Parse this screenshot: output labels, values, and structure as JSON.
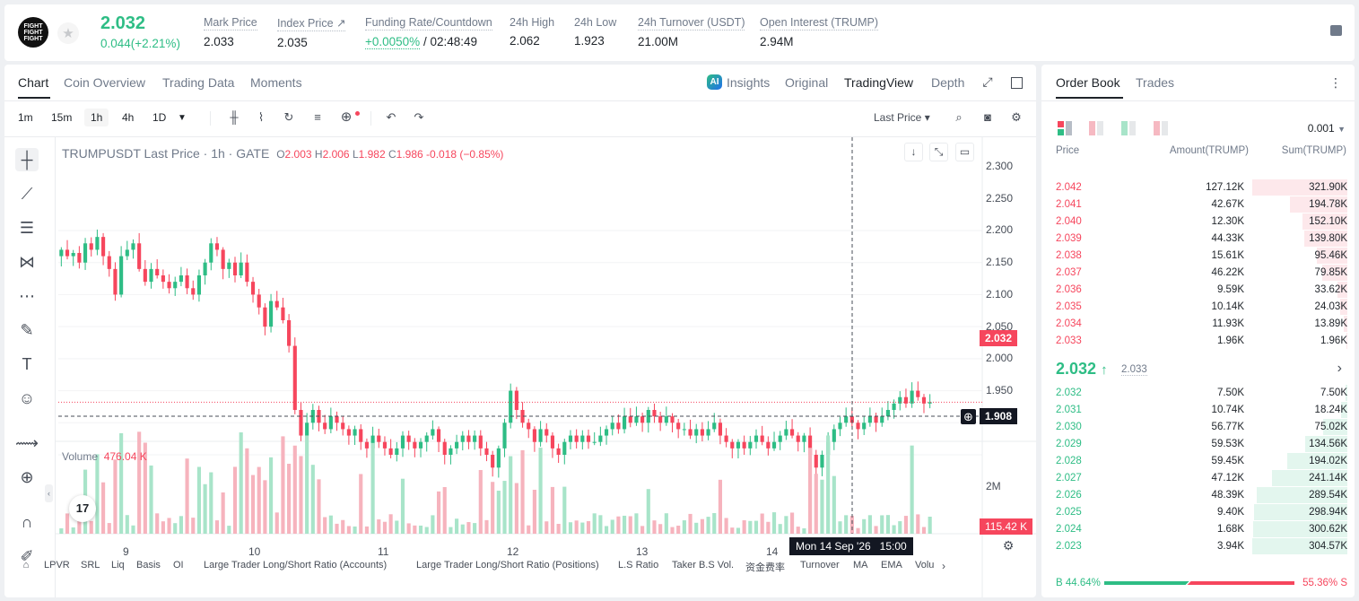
{
  "ticker": {
    "logo_text": "FIGHT FIGHT FIGHT",
    "price": "2.032",
    "change": "0.044(+2.21%)",
    "stats": [
      {
        "label": "Mark Price",
        "value": "2.033"
      },
      {
        "label": "Index Price ↗",
        "value": "2.035"
      },
      {
        "label": "Funding Rate/Countdown",
        "value_green": "+0.0050%",
        "value": " / 02:48:49"
      },
      {
        "label": "24h High",
        "value": "2.062"
      },
      {
        "label": "24h Low",
        "value": "1.923"
      },
      {
        "label": "24h Turnover (USDT)",
        "value": "21.00M"
      },
      {
        "label": "Open Interest (TRUMP)",
        "value": "2.94M"
      }
    ]
  },
  "chart_tabs": [
    "Chart",
    "Coin Overview",
    "Trading Data",
    "Moments"
  ],
  "view_tabs": {
    "ai": "AI",
    "insights": "Insights",
    "original": "Original",
    "tradingview": "TradingView",
    "depth": "Depth"
  },
  "toolbar": {
    "intervals": [
      "1m",
      "15m",
      "1h",
      "4h",
      "1D"
    ],
    "price_type": "Last Price ▾"
  },
  "legend": {
    "symbol": "TRUMPUSDT Last Price · 1h · GATE",
    "ohlc": {
      "o": "2.003",
      "h": "2.006",
      "l": "1.982",
      "c": "1.986",
      "chg": "-0.018 (−0.85%)"
    }
  },
  "price_axis": [
    "2.300",
    "2.250",
    "2.200",
    "2.150",
    "2.100",
    "2.050",
    "2.000",
    "1.950"
  ],
  "last_price_tag": "2.032",
  "crosshair_price": "1.908",
  "volume": {
    "label": "Volume",
    "value": "476.04 K",
    "axis_label": "2M",
    "last_tag": "115.42 K"
  },
  "time_axis": [
    "9",
    "10",
    "11",
    "12",
    "13",
    "14"
  ],
  "crosshair_time": "Mon 14 Sep '26   15:00",
  "tv_logo": "17",
  "indicators": [
    "LPVR",
    "SRL",
    "Liq",
    "Basis",
    "OI",
    "Large Trader Long/Short Ratio (Accounts)",
    "Large Trader Long/Short Ratio (Positions)",
    "L.S Ratio",
    "Taker B.S Vol.",
    "资金费率",
    "Turnover",
    "MA",
    "EMA",
    "Volu"
  ],
  "chart_data": {
    "type": "candlestick",
    "title": "TRUMPUSDT Last Price · 1h · GATE",
    "ylim": [
      1.9,
      2.31
    ],
    "closes": [
      2.27,
      2.26,
      2.265,
      2.25,
      2.28,
      2.27,
      2.29,
      2.26,
      2.24,
      2.2,
      2.26,
      2.27,
      2.28,
      2.24,
      2.22,
      2.24,
      2.23,
      2.22,
      2.21,
      2.22,
      2.23,
      2.21,
      2.2,
      2.23,
      2.25,
      2.28,
      2.27,
      2.24,
      2.25,
      2.23,
      2.25,
      2.22,
      2.2,
      2.18,
      2.15,
      2.19,
      2.18,
      2.16,
      2.12,
      2.02,
      1.98,
      2.0,
      2.02,
      2.0,
      1.99,
      2.01,
      2.0,
      1.99,
      1.98,
      1.99,
      1.97,
      1.96,
      1.98,
      1.97,
      1.96,
      1.95,
      1.96,
      1.98,
      1.97,
      1.96,
      1.97,
      1.98,
      1.99,
      1.97,
      1.95,
      1.96,
      1.97,
      1.98,
      1.97,
      1.98,
      1.96,
      1.95,
      1.93,
      1.96,
      2.0,
      2.05,
      2.02,
      2.0,
      1.99,
      1.97,
      1.99,
      1.98,
      1.96,
      1.95,
      1.97,
      1.98,
      1.97,
      1.98,
      1.97,
      1.97,
      1.98,
      1.99,
      2.0,
      1.99,
      2.01,
      2.0,
      2.01,
      2.0,
      2.02,
      2.01,
      2.0,
      2.01,
      2.0,
      1.99,
      1.99,
      1.98,
      1.99,
      1.98,
      1.99,
      2.0,
      1.98,
      1.97,
      1.96,
      1.97,
      1.96,
      1.97,
      1.98,
      1.97,
      1.96,
      1.97,
      1.98,
      1.99,
      1.98,
      1.97,
      1.98,
      1.95,
      1.93,
      1.95,
      1.97,
      1.99,
      2.0,
      2.01,
      2.0,
      1.99,
      2.0,
      2.01,
      2.0,
      2.01,
      2.02,
      2.03,
      2.04,
      2.03,
      2.05,
      2.04,
      2.03,
      2.032
    ],
    "volume_unit": "K",
    "last_price": 2.032
  },
  "book": {
    "tabs": [
      "Order Book",
      "Trades"
    ],
    "precision": "0.001",
    "headers": [
      "Price",
      "Amount(TRUMP)",
      "Sum(TRUMP)"
    ],
    "asks": [
      {
        "price": "2.042",
        "amount": "127.12K",
        "sum": "321.90K",
        "depth": 0.95
      },
      {
        "price": "2.041",
        "amount": "42.67K",
        "sum": "194.78K",
        "depth": 0.57
      },
      {
        "price": "2.040",
        "amount": "12.30K",
        "sum": "152.10K",
        "depth": 0.45
      },
      {
        "price": "2.039",
        "amount": "44.33K",
        "sum": "139.80K",
        "depth": 0.43
      },
      {
        "price": "2.038",
        "amount": "15.61K",
        "sum": "95.46K",
        "depth": 0.3
      },
      {
        "price": "2.037",
        "amount": "46.22K",
        "sum": "79.85K",
        "depth": 0.25
      },
      {
        "price": "2.036",
        "amount": "9.59K",
        "sum": "33.62K",
        "depth": 0.1
      },
      {
        "price": "2.035",
        "amount": "10.14K",
        "sum": "24.03K",
        "depth": 0.07
      },
      {
        "price": "2.034",
        "amount": "11.93K",
        "sum": "13.89K",
        "depth": 0.04
      },
      {
        "price": "2.033",
        "amount": "1.96K",
        "sum": "1.96K",
        "depth": 0.01
      }
    ],
    "mid_price": "2.032",
    "mid_arrow": "↑",
    "mid_mark": "2.033",
    "bids": [
      {
        "price": "2.032",
        "amount": "7.50K",
        "sum": "7.50K",
        "depth": 0.02
      },
      {
        "price": "2.031",
        "amount": "10.74K",
        "sum": "18.24K",
        "depth": 0.06
      },
      {
        "price": "2.030",
        "amount": "56.77K",
        "sum": "75.02K",
        "depth": 0.24
      },
      {
        "price": "2.029",
        "amount": "59.53K",
        "sum": "134.56K",
        "depth": 0.42
      },
      {
        "price": "2.028",
        "amount": "59.45K",
        "sum": "194.02K",
        "depth": 0.6
      },
      {
        "price": "2.027",
        "amount": "47.12K",
        "sum": "241.14K",
        "depth": 0.75
      },
      {
        "price": "2.026",
        "amount": "48.39K",
        "sum": "289.54K",
        "depth": 0.9
      },
      {
        "price": "2.025",
        "amount": "9.40K",
        "sum": "298.94K",
        "depth": 0.93
      },
      {
        "price": "2.024",
        "amount": "1.68K",
        "sum": "300.62K",
        "depth": 0.94
      },
      {
        "price": "2.023",
        "amount": "3.94K",
        "sum": "304.57K",
        "depth": 0.95
      }
    ],
    "buy_ratio": "B 44.64%",
    "sell_ratio": "55.36% S",
    "buy_fraction": 0.4464
  },
  "colors": {
    "up": "#2ebd85",
    "down": "#f6465d",
    "text": "#1e2329",
    "muted": "#707a8a"
  }
}
